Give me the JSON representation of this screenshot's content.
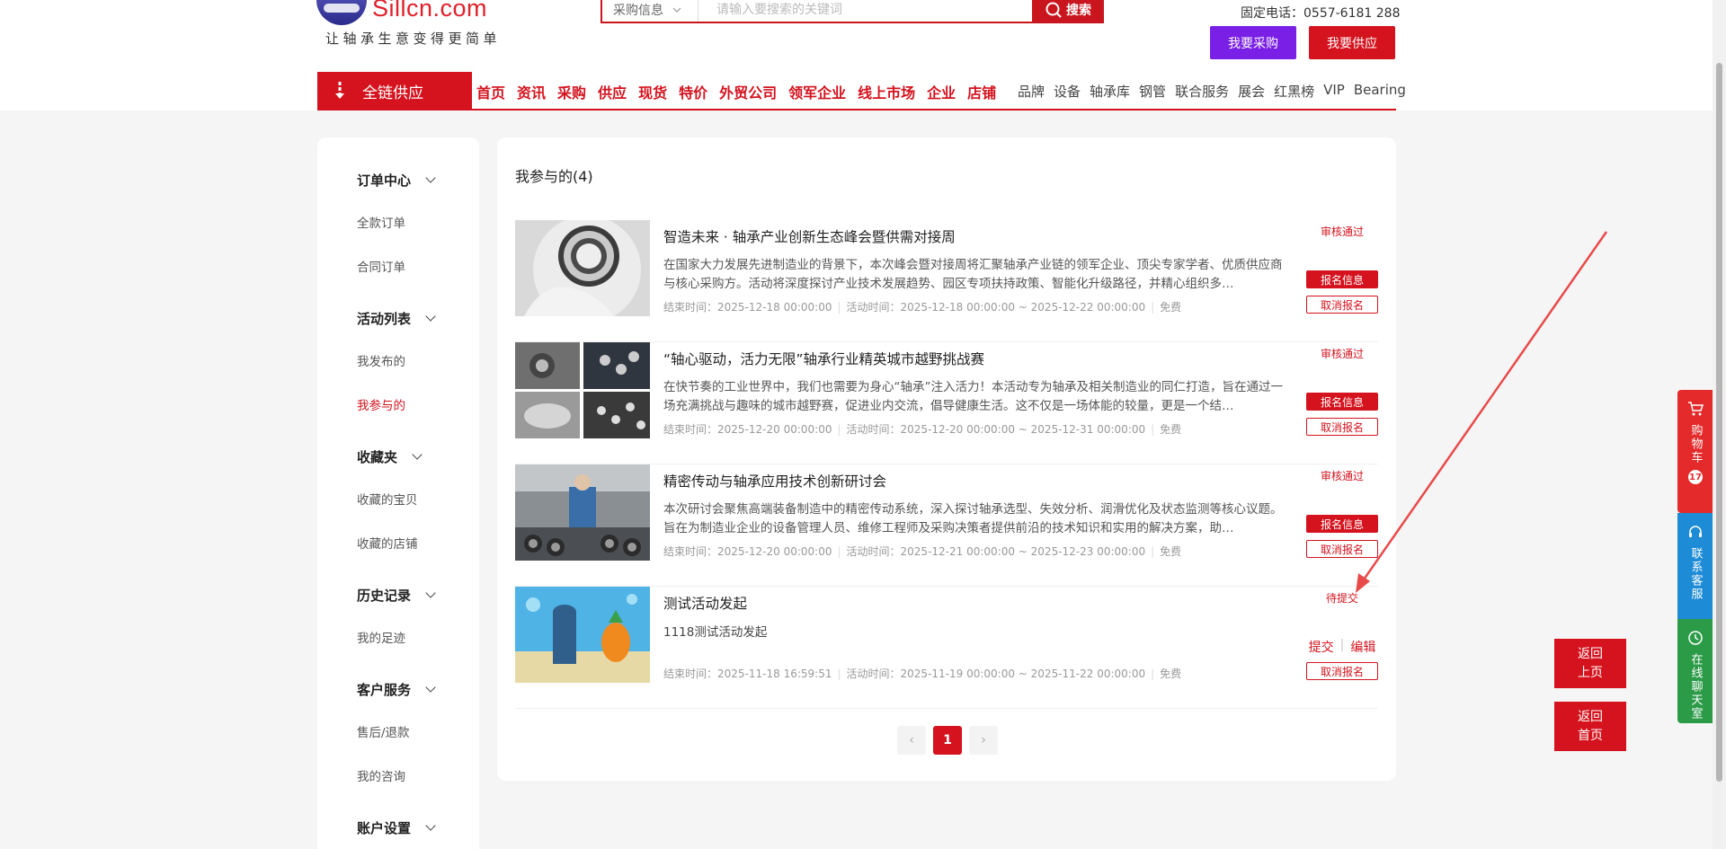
{
  "header": {
    "logo_text": "Sillcn.com",
    "slogan": "让轴承生意变得更简单",
    "search": {
      "category": "采购信息",
      "placeholder": "请输入要搜索的关键词",
      "button": "搜索"
    },
    "phone": "固定电话：0557-6181 288",
    "buy_button": "我要采购",
    "supply_button": "我要供应"
  },
  "nav": {
    "chain_label": "全链供应",
    "main_items": [
      "首页",
      "资讯",
      "采购",
      "供应",
      "现货",
      "特价",
      "外贸公司",
      "领军企业",
      "线上市场",
      "企业",
      "店铺"
    ],
    "sub_items": [
      "品牌",
      "设备",
      "轴承库",
      "钢管",
      "联合服务",
      "展会",
      "红黑榜",
      "VIP",
      "Bearing"
    ]
  },
  "sidebar": {
    "groups": [
      {
        "title": "订单中心",
        "items": [
          "全款订单",
          "合同订单"
        ]
      },
      {
        "title": "活动列表",
        "items": [
          "我发布的",
          "我参与的"
        ]
      },
      {
        "title": "收藏夹",
        "items": [
          "收藏的宝贝",
          "收藏的店铺"
        ]
      },
      {
        "title": "历史记录",
        "items": [
          "我的足迹"
        ]
      },
      {
        "title": "客户服务",
        "items": [
          "售后/退款",
          "我的咨询"
        ]
      },
      {
        "title": "账户设置",
        "items": []
      }
    ],
    "active_item": "我参与的"
  },
  "main": {
    "title": "我参与的(4)",
    "labels": {
      "end_time": "结束时间：",
      "activity_time": "活动时间："
    },
    "activities": [
      {
        "title": "智造未来 · 轴承产业创新生态峰会暨供需对接周",
        "desc": "在国家大力发展先进制造业的背景下，本次峰会暨对接周将汇聚轴承产业链的领军企业、顶尖专家学者、优质供应商与核心采购方。活动将深度探讨产业技术发展趋势、园区专项扶持政策、智能化升级路径，并精心组织多…",
        "end_time": "2025-12-18 00:00:00",
        "activity_time": "2025-12-18 00:00:00 ~ 2025-12-22 00:00:00",
        "fee": "免费",
        "status": "审核通过",
        "btn_info": "报名信息",
        "btn_cancel": "取消报名"
      },
      {
        "title": "“轴心驱动，活力无限”轴承行业精英城市越野挑战赛",
        "desc": "在快节奏的工业世界中，我们也需要为身心“轴承”注入活力！本活动专为轴承及相关制造业的同仁打造，旨在通过一场充满挑战与趣味的城市越野赛，促进业内交流，倡导健康生活。这不仅是一场体能的较量，更是一个结…",
        "end_time": "2025-12-20 00:00:00",
        "activity_time": "2025-12-20 00:00:00 ~ 2025-12-31 00:00:00",
        "fee": "免费",
        "status": "审核通过",
        "btn_info": "报名信息",
        "btn_cancel": "取消报名"
      },
      {
        "title": "精密传动与轴承应用技术创新研讨会",
        "desc": "本次研讨会聚焦高端装备制造中的精密传动系统，深入探讨轴承选型、失效分析、润滑优化及状态监测等核心议题。旨在为制造业企业的设备管理人员、维修工程师及采购决策者提供前沿的技术知识和实用的解决方案，助…",
        "end_time": "2025-12-20 00:00:00",
        "activity_time": "2025-12-21 00:00:00 ~ 2025-12-23 00:00:00",
        "fee": "免费",
        "status": "审核通过",
        "btn_info": "报名信息",
        "btn_cancel": "取消报名"
      },
      {
        "title": "测试活动发起",
        "desc": "1118测试活动发起",
        "end_time": "2025-11-18 16:59:51",
        "activity_time": "2025-11-19 00:00:00 ~ 2025-11-22 00:00:00",
        "fee": "免费",
        "status": "待提交",
        "btn_submit": "提交",
        "btn_edit": "编辑",
        "btn_cancel": "取消报名"
      }
    ],
    "pagination": {
      "prev": "‹",
      "current": "1",
      "next": "›"
    }
  },
  "float": {
    "cart": "购物车",
    "cart_count": "17",
    "service": "联系客服",
    "chat": "在线聊天室",
    "back_prev_1": "返回",
    "back_prev_2": "上页",
    "back_home_1": "返回",
    "back_home_2": "首页"
  },
  "colors": {
    "brand_red": "#d4131e",
    "purple": "#7a1fe6",
    "service_blue": "#1d8bd6",
    "chat_green": "#2c9b48"
  }
}
